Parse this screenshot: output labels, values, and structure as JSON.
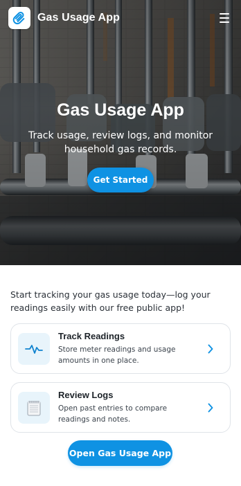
{
  "app": {
    "title": "Gas Usage App"
  },
  "header": {
    "menu_label": "Menu"
  },
  "hero": {
    "title": "Gas Usage App",
    "subtitle": "Track usage, review logs, and monitor household gas records.",
    "cta_label": "Get Started"
  },
  "main": {
    "intro": "Start tracking your gas usage today—log your readings easily with our free public app!",
    "cards": [
      {
        "title": "Track Readings",
        "description": "Store meter readings and usage amounts in one place.",
        "icon": "activity-icon"
      },
      {
        "title": "Review Logs",
        "description": "Open past entries to compare readings and notes.",
        "icon": "notepad-icon"
      }
    ],
    "bottom_cta_label": "Open Gas Usage App"
  },
  "colors": {
    "accent": "#0f92e3",
    "card_border": "#dfe3e8",
    "icon_bg": "#e8f4fb"
  }
}
